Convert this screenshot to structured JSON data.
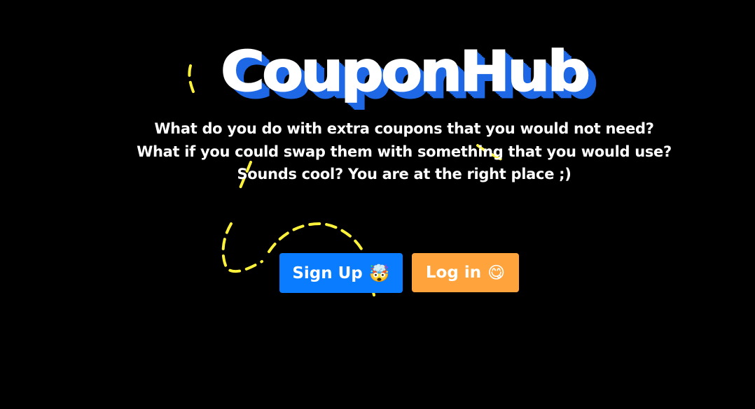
{
  "logo": {
    "text": "CouponHub"
  },
  "tagline": {
    "line1": "What do you do with extra coupons that you would not need?",
    "line2": "What if you could swap them with something that you would use?",
    "line3": "Sounds cool? You are at the right place ;)"
  },
  "actions": {
    "signup_label": "Sign Up",
    "signup_emoji": "🤯",
    "login_label": "Log in",
    "login_emoji": "😋"
  },
  "colors": {
    "background": "#000000",
    "logo_text": "#ffffff",
    "logo_shadow": "#1e68e6",
    "signup_button": "#0a7cff",
    "login_button": "#ffa43c",
    "scribble": "#fff23a"
  }
}
